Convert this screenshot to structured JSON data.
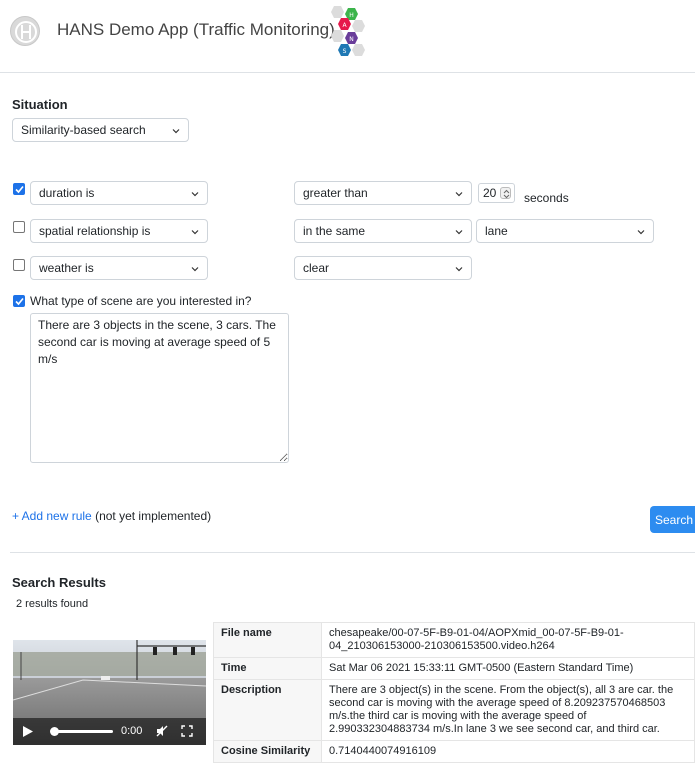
{
  "header": {
    "app_title": "HANS Demo App (Traffic Monitoring)",
    "hex_letters": [
      "H",
      "A",
      "N",
      "S"
    ],
    "colors": {
      "h": "#3cb44b",
      "a": "#e6194b",
      "n": "#6a3d9a",
      "s": "#1f78b4"
    }
  },
  "situation": {
    "heading": "Situation",
    "mode": "Similarity-based search"
  },
  "rules": [
    {
      "checked": true,
      "field": "duration is",
      "op": "greater than",
      "value": "20",
      "unit": "seconds"
    },
    {
      "checked": false,
      "field": "spatial relationship is",
      "op": "in the same",
      "value": "lane"
    },
    {
      "checked": false,
      "field": "weather is",
      "op": "clear"
    }
  ],
  "scene": {
    "checked": true,
    "question": "What type of scene are you interested in?",
    "text": "There are 3 objects in the scene, 3 cars. The second car is moving at average speed of 5 m/s"
  },
  "add_rule": {
    "link": "+ Add new rule",
    "note": " (not yet implemented)"
  },
  "search_button": "Search",
  "results": {
    "heading": "Search Results",
    "count": "2 results found",
    "video": {
      "time": "0:00",
      "progress": 0
    },
    "rows": [
      {
        "label": "File name",
        "value": "chesapeake/00-07-5F-B9-01-04/AOPXmid_00-07-5F-B9-01-04_210306153000-210306153500.video.h264"
      },
      {
        "label": "Time",
        "value": "Sat Mar 06 2021 15:33:11 GMT-0500 (Eastern Standard Time)"
      },
      {
        "label": "Description",
        "value": "There are 3 object(s) in the scene. From the object(s), all 3 are car. the second car is moving with the average speed of 8.209237570468503 m/s.the third car is moving with the average speed of 2.990332304883734 m/s.In lane 3 we see second car, and third car."
      },
      {
        "label": "Cosine Similarity",
        "value": "0.7140440074916109"
      }
    ]
  }
}
